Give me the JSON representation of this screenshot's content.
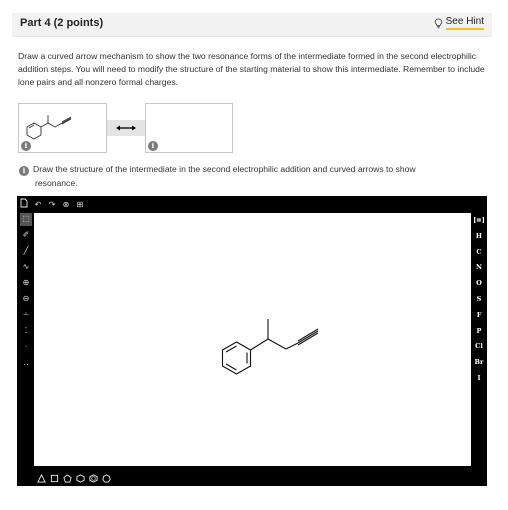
{
  "header": {
    "part_title": "Part 4   (2 points)",
    "hint_label": "See Hint"
  },
  "question": {
    "text": "Draw a curved arrow mechanism to show the two resonance forms of the intermediate formed in the second electrophilic addition steps. You will need to modify the structure of the starting material to show this intermediate. Remember to include lone pairs and all nonzero formal charges."
  },
  "previews": {
    "arrow_symbol": "↔",
    "info_symbol": "i"
  },
  "instruction": {
    "line1": "Draw the structure of the intermediate in the second electrophilic addition and curved arrows to show",
    "line2": "resonance."
  },
  "editor": {
    "top_tools": [
      "new-document",
      "undo",
      "redo",
      "zoom",
      "template"
    ],
    "left_tools": [
      "select",
      "eraser",
      "bond",
      "chain",
      "plus-charge",
      "minus-charge",
      "lone-pair",
      "radical",
      "electron-dot",
      "double-dot"
    ],
    "left_tool_glyphs": [
      "⬚",
      "✐",
      "╱",
      "∿",
      "⊕",
      "⊖",
      "∸",
      "⁚",
      "·",
      "‥"
    ],
    "elements": [
      "H",
      "C",
      "N",
      "O",
      "S",
      "F",
      "P",
      "Cl",
      "Br",
      "I"
    ],
    "periodic_table_label": "[≡]",
    "bottom_shapes": [
      "triangle",
      "square",
      "pentagon",
      "hexagon",
      "benzene",
      "heptagon"
    ],
    "accent_color": "#000000"
  }
}
